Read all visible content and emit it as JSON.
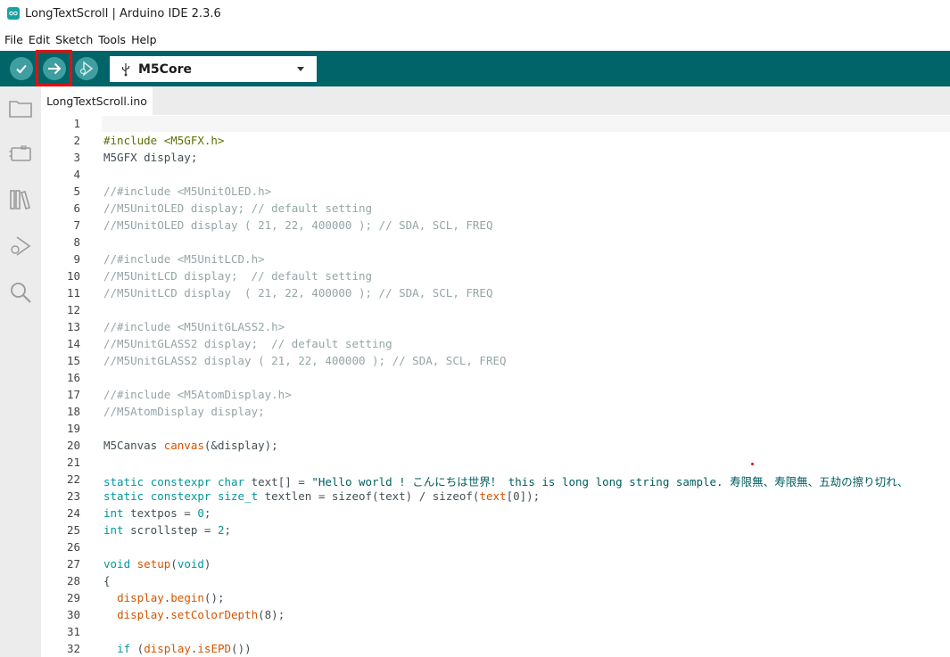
{
  "window": {
    "title": "LongTextScroll | Arduino IDE 2.3.6"
  },
  "menu": [
    "File",
    "Edit",
    "Sketch",
    "Tools",
    "Help"
  ],
  "toolbar": {
    "verify_icon": "check-icon",
    "upload_icon": "arrow-right-icon",
    "debug_icon": "debug-icon",
    "board": "M5Core",
    "board_icon": "usb-icon"
  },
  "sidebar": [
    "folder-icon",
    "board-manager-icon",
    "library-icon",
    "debug-icon",
    "search-icon"
  ],
  "tab": {
    "label": "LongTextScroll.ino"
  },
  "colors": {
    "toolbar": "#006468",
    "button": "#3f9ea0",
    "highlight": "#e01010"
  },
  "editor": {
    "lines": [
      {
        "n": "1",
        "parts": []
      },
      {
        "n": "2",
        "parts": [
          [
            "#include <M5GFX.h>",
            "dir"
          ]
        ]
      },
      {
        "n": "3",
        "parts": [
          [
            "M5GFX display;",
            "plain"
          ]
        ]
      },
      {
        "n": "4",
        "parts": []
      },
      {
        "n": "5",
        "parts": [
          [
            "//#include <M5UnitOLED.h>",
            "cmt"
          ]
        ]
      },
      {
        "n": "6",
        "parts": [
          [
            "//M5UnitOLED display; // default setting",
            "cmt"
          ]
        ]
      },
      {
        "n": "7",
        "parts": [
          [
            "//M5UnitOLED display ( 21, 22, 400000 ); // SDA, SCL, FREQ",
            "cmt"
          ]
        ]
      },
      {
        "n": "8",
        "parts": []
      },
      {
        "n": "9",
        "parts": [
          [
            "//#include <M5UnitLCD.h>",
            "cmt"
          ]
        ]
      },
      {
        "n": "10",
        "parts": [
          [
            "//M5UnitLCD display;  // default setting",
            "cmt"
          ]
        ]
      },
      {
        "n": "11",
        "parts": [
          [
            "//M5UnitLCD display  ( 21, 22, 400000 ); // SDA, SCL, FREQ",
            "cmt"
          ]
        ]
      },
      {
        "n": "12",
        "parts": []
      },
      {
        "n": "13",
        "parts": [
          [
            "//#include <M5UnitGLASS2.h>",
            "cmt"
          ]
        ]
      },
      {
        "n": "14",
        "parts": [
          [
            "//M5UnitGLASS2 display;  // default setting",
            "cmt"
          ]
        ]
      },
      {
        "n": "15",
        "parts": [
          [
            "//M5UnitGLASS2 display ( 21, 22, 400000 ); // SDA, SCL, FREQ",
            "cmt"
          ]
        ]
      },
      {
        "n": "16",
        "parts": []
      },
      {
        "n": "17",
        "parts": [
          [
            "//#include <M5AtomDisplay.h>",
            "cmt"
          ]
        ]
      },
      {
        "n": "18",
        "parts": [
          [
            "//M5AtomDisplay display;",
            "cmt"
          ]
        ]
      },
      {
        "n": "19",
        "parts": []
      },
      {
        "n": "20",
        "parts": [
          [
            "M5Canvas ",
            "plain"
          ],
          [
            "canvas",
            "fn"
          ],
          [
            "(&display);",
            "plain"
          ]
        ]
      },
      {
        "n": "21",
        "parts": []
      },
      {
        "n": "22",
        "parts": [
          [
            "static",
            "kw"
          ],
          [
            " ",
            "plain"
          ],
          [
            "constexpr",
            "kw"
          ],
          [
            " ",
            "plain"
          ],
          [
            "char",
            "kw"
          ],
          [
            " text[] = ",
            "plain"
          ],
          [
            "\"Hello world ! こんにちは世界！ this is long long string sample. 寿限無、寿限無、五劫の擦り切れ、",
            "str"
          ]
        ]
      },
      {
        "n": "23",
        "parts": [
          [
            "static",
            "kw"
          ],
          [
            " ",
            "plain"
          ],
          [
            "constexpr",
            "kw"
          ],
          [
            " ",
            "plain"
          ],
          [
            "size_t",
            "kw"
          ],
          [
            " textlen = sizeof(text) / sizeof(",
            "plain"
          ],
          [
            "text",
            "fn"
          ],
          [
            "[0]);",
            "plain"
          ]
        ]
      },
      {
        "n": "24",
        "parts": [
          [
            "int",
            "kw"
          ],
          [
            " textpos = ",
            "plain"
          ],
          [
            "0",
            "kw"
          ],
          [
            ";",
            "plain"
          ]
        ]
      },
      {
        "n": "25",
        "parts": [
          [
            "int",
            "kw"
          ],
          [
            " scrollstep = ",
            "plain"
          ],
          [
            "2",
            "kw"
          ],
          [
            ";",
            "plain"
          ]
        ]
      },
      {
        "n": "26",
        "parts": []
      },
      {
        "n": "27",
        "parts": [
          [
            "void",
            "kw"
          ],
          [
            " ",
            "plain"
          ],
          [
            "setup",
            "fn"
          ],
          [
            "(",
            "plain"
          ],
          [
            "void",
            "kw"
          ],
          [
            ")",
            "plain"
          ]
        ]
      },
      {
        "n": "28",
        "parts": [
          [
            "{",
            "plain"
          ]
        ]
      },
      {
        "n": "29",
        "parts": [
          [
            "  ",
            "plain"
          ],
          [
            "display",
            "fn"
          ],
          [
            ".",
            "plain"
          ],
          [
            "begin",
            "fn"
          ],
          [
            "();",
            "plain"
          ]
        ]
      },
      {
        "n": "30",
        "parts": [
          [
            "  ",
            "plain"
          ],
          [
            "display",
            "fn"
          ],
          [
            ".",
            "plain"
          ],
          [
            "setColorDepth",
            "fn"
          ],
          [
            "(8);",
            "plain"
          ]
        ]
      },
      {
        "n": "31",
        "parts": []
      },
      {
        "n": "32",
        "parts": [
          [
            "  ",
            "plain"
          ],
          [
            "if",
            "kw"
          ],
          [
            " (",
            "plain"
          ],
          [
            "display",
            "fn"
          ],
          [
            ".",
            "plain"
          ],
          [
            "isEPD",
            "fn"
          ],
          [
            "())",
            "plain"
          ]
        ]
      }
    ]
  }
}
